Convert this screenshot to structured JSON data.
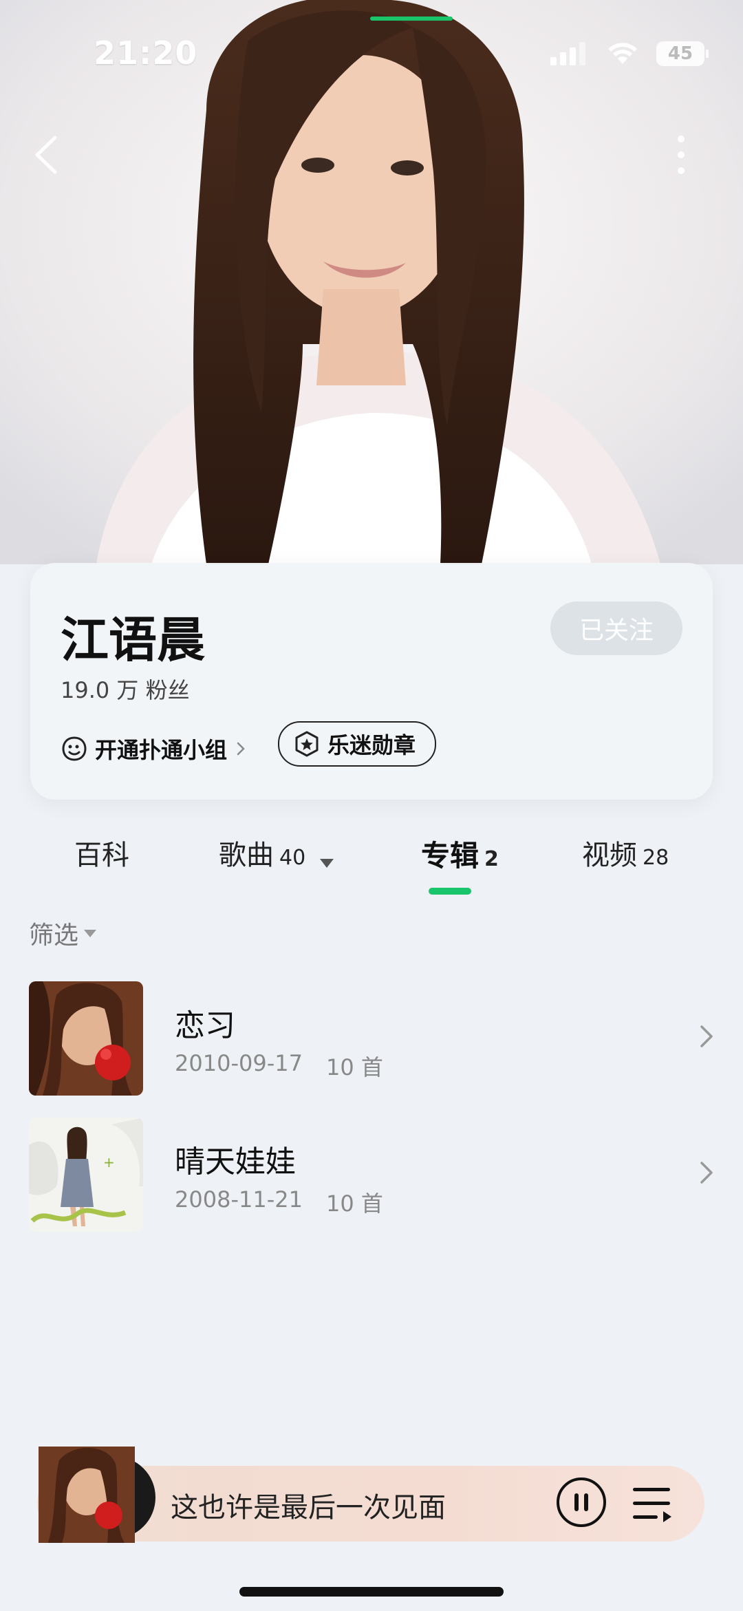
{
  "status_bar": {
    "time": "21:20",
    "battery": "45"
  },
  "artist": {
    "name": "江语晨",
    "fans": "19.0 万 粉丝",
    "follow_label": "已关注",
    "group_link_label": "开通扑通小组",
    "badge_label": "乐迷勋章"
  },
  "tabs": [
    {
      "label": "百科",
      "count": ""
    },
    {
      "label": "歌曲",
      "count": "40"
    },
    {
      "label": "专辑",
      "count": "2"
    },
    {
      "label": "视频",
      "count": "28"
    }
  ],
  "active_tab": "专辑",
  "filter_label": "筛选",
  "albums": [
    {
      "title": "恋习",
      "date": "2010-09-17",
      "tracks": "10 首"
    },
    {
      "title": "晴天娃娃",
      "date": "2008-11-21",
      "tracks": "10 首"
    }
  ],
  "player": {
    "title": "这也许是最后一次见面",
    "state": "playing"
  },
  "colors": {
    "accent": "#19c46a",
    "background": "#eef2f7",
    "player_bg": "#f2ddd3"
  }
}
